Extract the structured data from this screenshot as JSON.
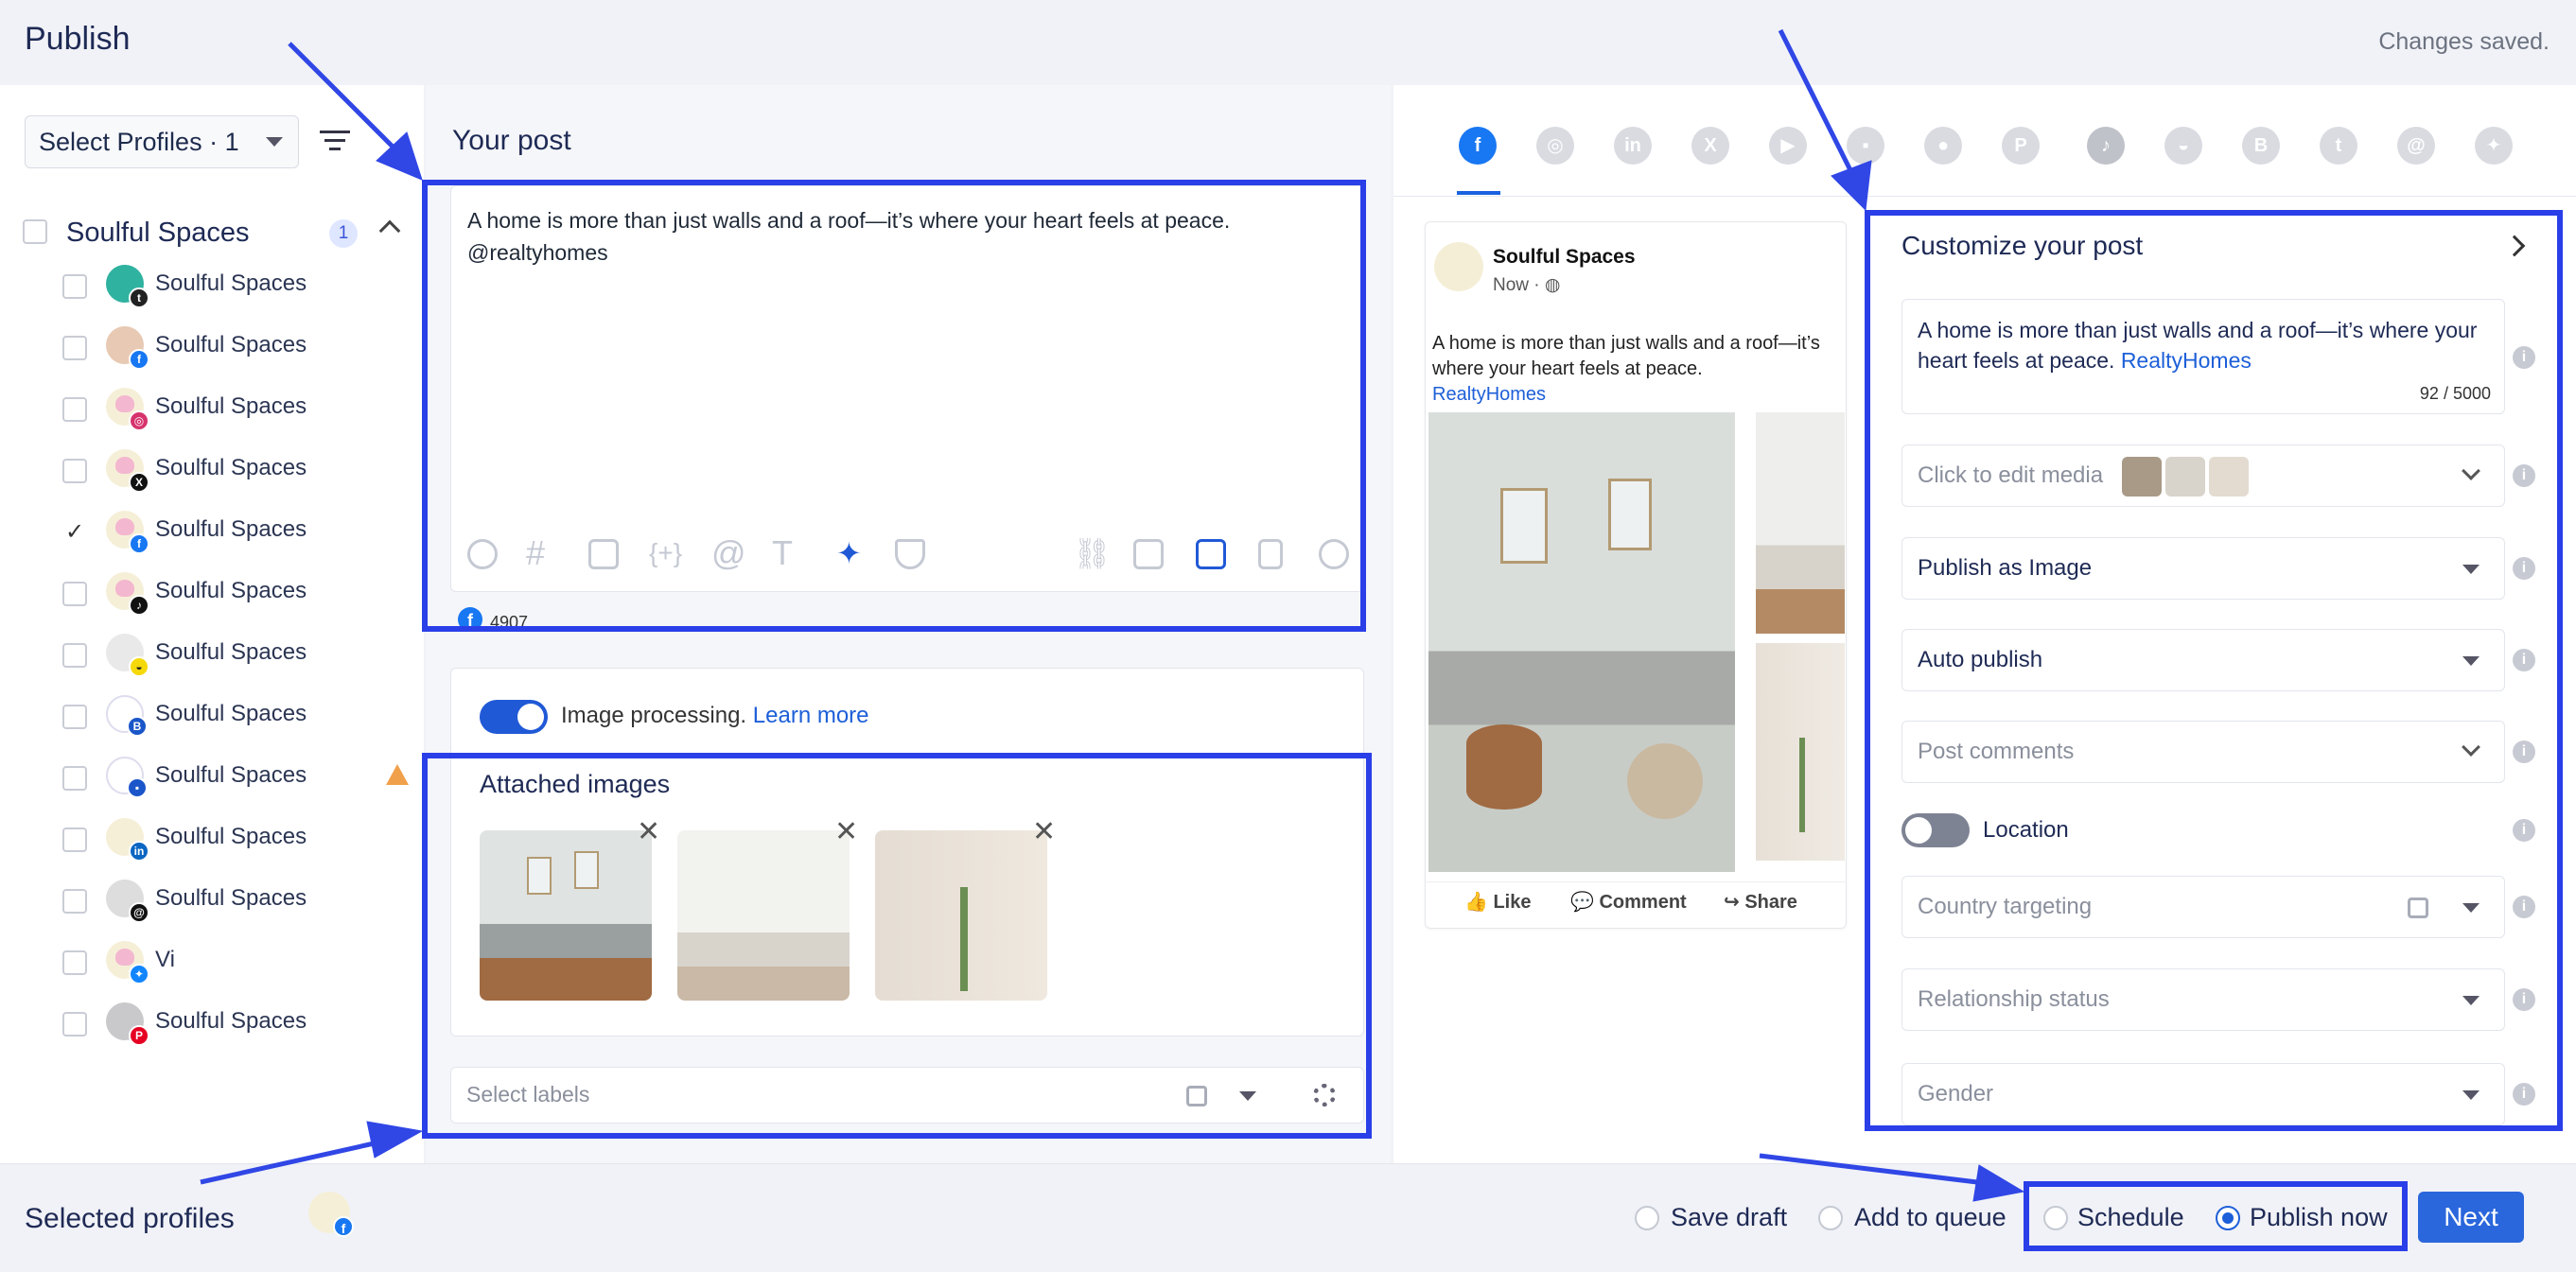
{
  "header": {
    "title": "Publish",
    "status": "Changes saved."
  },
  "sidebar": {
    "select_label": "Select Profiles · 1",
    "group": {
      "name": "Soulful Spaces",
      "count": "1"
    },
    "profiles": [
      {
        "name": "Soulful Spaces",
        "network": "threads",
        "checked": false
      },
      {
        "name": "Soulful Spaces",
        "network": "facebook",
        "checked": false
      },
      {
        "name": "Soulful Spaces",
        "network": "instagram",
        "checked": false
      },
      {
        "name": "Soulful Spaces",
        "network": "x",
        "checked": false
      },
      {
        "name": "Soulful Spaces",
        "network": "facebook",
        "checked": true
      },
      {
        "name": "Soulful Spaces",
        "network": "tiktok",
        "checked": false
      },
      {
        "name": "Soulful Spaces",
        "network": "snapchat",
        "checked": false
      },
      {
        "name": "Soulful Spaces",
        "network": "google-business",
        "checked": false
      },
      {
        "name": "Soulful Spaces",
        "network": "google-business",
        "checked": false,
        "warning": true
      },
      {
        "name": "Soulful Spaces",
        "network": "linkedin",
        "checked": false
      },
      {
        "name": "Soulful Spaces",
        "network": "threads",
        "checked": false
      },
      {
        "name": "Vi",
        "network": "bluesky",
        "checked": false
      },
      {
        "name": "Soulful Spaces",
        "network": "pinterest",
        "checked": false
      }
    ]
  },
  "editor": {
    "heading": "Your post",
    "text_line1": "A home is more than just walls and a roof—it’s where your heart feels at peace.",
    "text_line2": "@realtyhomes",
    "char_count": "4907"
  },
  "media": {
    "processing_label": "Image processing.",
    "learn_more": "Learn more",
    "attached_heading": "Attached images",
    "labels_placeholder": "Select labels"
  },
  "preview": {
    "name": "Soulful Spaces",
    "time": "Now · ",
    "text": "A home is more than just walls and a roof—it’s where your heart feels at peace.",
    "link": "RealtyHomes",
    "like": "Like",
    "comment": "Comment",
    "share": "Share"
  },
  "customize": {
    "title": "Customize your post",
    "text": "A home is more than just walls and a roof—it’s where your heart feels at peace.",
    "mention": "RealtyHomes",
    "counter": "92 / 5000",
    "media_label": "Click to edit media",
    "publish_as": "Publish as Image",
    "auto_publish": "Auto publish",
    "post_comments": "Post comments",
    "location": "Location",
    "country": "Country targeting",
    "relationship": "Relationship status",
    "gender": "Gender"
  },
  "footer": {
    "selected_profiles": "Selected profiles",
    "save_draft": "Save draft",
    "add_to_queue": "Add to queue",
    "schedule": "Schedule",
    "publish_now": "Publish now",
    "next": "Next"
  },
  "colors": {
    "accent": "#2a66dc",
    "highlight": "#2a3fe8",
    "facebook": "#1877f2"
  }
}
